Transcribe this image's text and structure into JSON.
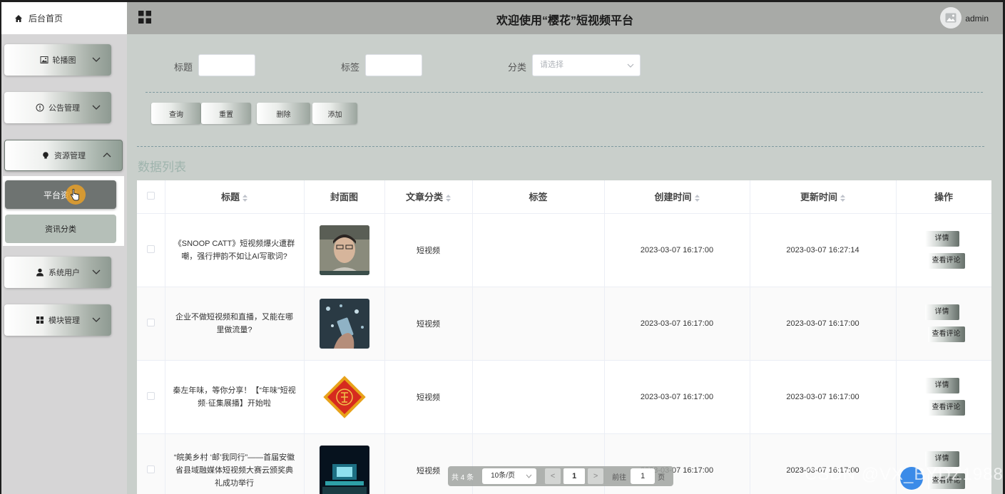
{
  "sidebar": {
    "home": "后台首页",
    "menus": [
      {
        "label": "轮播图",
        "icon": "image-icon"
      },
      {
        "label": "公告管理",
        "icon": "info-circle-icon"
      },
      {
        "label": "资源管理",
        "icon": "bulb-icon",
        "open": true
      },
      {
        "label": "系统用户",
        "icon": "user-icon"
      },
      {
        "label": "模块管理",
        "icon": "grid-icon"
      }
    ],
    "submenu": [
      {
        "label": "平台资讯",
        "active": true
      },
      {
        "label": "资讯分类",
        "active": false
      }
    ]
  },
  "header": {
    "title": "欢迎使用“樱花”短视频平台",
    "user": "admin"
  },
  "filters": {
    "title_label": "标题",
    "tag_label": "标签",
    "category_label": "分类",
    "category_placeholder": "请选择"
  },
  "actions": {
    "query": "查询",
    "reset": "重置",
    "delete": "删除",
    "add": "添加"
  },
  "list_title": "数据列表",
  "table": {
    "columns": [
      "标题",
      "封面图",
      "文章分类",
      "标签",
      "创建时间",
      "更新时间",
      "操作"
    ],
    "rows": [
      {
        "title": "《SNOOP CATT》短视频爆火遭群嘲，强行押韵不如让AI写歌词?",
        "category": "短视频",
        "tag": "",
        "created": "2023-03-07 16:17:00",
        "updated": "2023-03-07 16:27:14"
      },
      {
        "title": "企业不做短视频和直播，又能在哪里做流量?",
        "category": "短视频",
        "tag": "",
        "created": "2023-03-07 16:17:00",
        "updated": "2023-03-07 16:17:00"
      },
      {
        "title": "秦左年味，等你分享！【“年味”短视频·征集展播】开始啦",
        "category": "短视频",
        "tag": "",
        "created": "2023-03-07 16:17:00",
        "updated": "2023-03-07 16:17:00"
      },
      {
        "title": "“皖美乡村 ‘邮’我同行”——首届安徽省县域融媒体短视频大赛云颁奖典礼成功举行",
        "category": "短视频",
        "tag": "",
        "created": "2023-03-07 16:17:00",
        "updated": "2023-03-07 16:17:00"
      }
    ],
    "detail_btn": "详情",
    "comment_btn": "查看评论"
  },
  "pagination": {
    "total": "共 4 条",
    "page_size": "10条/页",
    "prev": "<",
    "current": "1",
    "next": ">",
    "goto": "前往",
    "goto_value": "1",
    "page_unit": "页"
  },
  "watermark": "CSDN @VX_BYDZ1988"
}
